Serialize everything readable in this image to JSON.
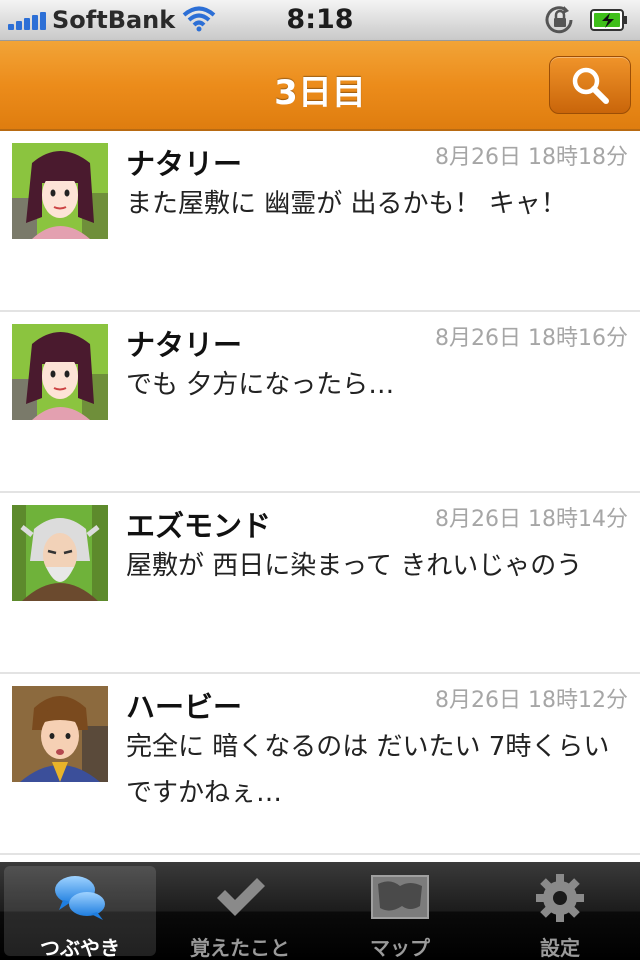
{
  "status_bar": {
    "carrier": "SoftBank",
    "time": "8:18"
  },
  "nav": {
    "title": "3日目",
    "search_icon": "search-icon"
  },
  "feed": [
    {
      "name": "ナタリー",
      "time": "8月26日 18時18分",
      "message": "また屋敷に 幽霊が 出るかも！ キャ！",
      "avatar": "natalie"
    },
    {
      "name": "ナタリー",
      "time": "8月26日 18時16分",
      "message": "でも 夕方になったら…",
      "avatar": "natalie"
    },
    {
      "name": "エズモンド",
      "time": "8月26日 18時14分",
      "message": "屋敷が 西日に染まって きれいじゃのう",
      "avatar": "esmond"
    },
    {
      "name": "ハービー",
      "time": "8月26日 18時12分",
      "message": "完全に 暗くなるのは だいたい 7時くらいですかねぇ…",
      "avatar": "harvey"
    }
  ],
  "tabs": [
    {
      "label": "つぶやき",
      "icon": "speech-bubbles-icon",
      "active": true
    },
    {
      "label": "覚えたこと",
      "icon": "checkmark-icon",
      "active": false
    },
    {
      "label": "マップ",
      "icon": "map-icon",
      "active": false
    },
    {
      "label": "設定",
      "icon": "gear-icon",
      "active": false
    }
  ],
  "colors": {
    "nav_orange": "#ec8c1b",
    "timestamp_gray": "#a6a6a6",
    "signal_blue": "#2c6fd6",
    "battery_green": "#3fbf1a"
  }
}
